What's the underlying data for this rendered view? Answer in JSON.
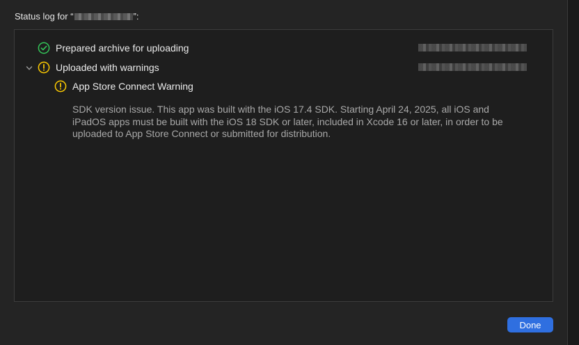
{
  "dialog": {
    "title_prefix": "Status log for “",
    "title_suffix": "”:"
  },
  "log": {
    "entries": [
      {
        "label": "Prepared archive for uploading",
        "status": "success",
        "icon": "checkmark-circle-icon"
      },
      {
        "label": "Uploaded with warnings",
        "status": "warning",
        "icon": "warning-circle-icon",
        "expanded": true,
        "children": [
          {
            "label": "App Store Connect Warning",
            "status": "warning",
            "icon": "warning-circle-icon",
            "message": "SDK version issue. This app was built with the iOS 17.4 SDK. Starting April 24, 2025, all iOS and iPadOS apps must be built with the iOS 18 SDK or later, included in Xcode 16 or later, in order to be uploaded to App Store Connect or submitted for distribution."
          }
        ]
      }
    ]
  },
  "buttons": {
    "done_label": "Done"
  },
  "colors": {
    "success": "#34c759",
    "warning": "#ffcc00",
    "accent": "#2f6fe0"
  }
}
